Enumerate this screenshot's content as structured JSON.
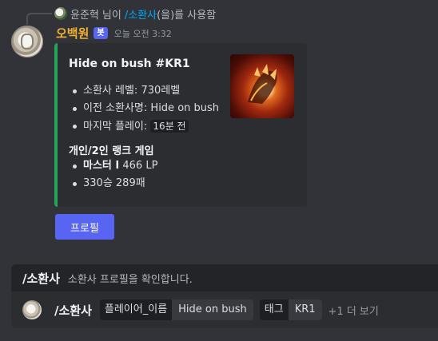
{
  "reply": {
    "user": "윤준혁",
    "suffix": "님이",
    "command": "/소환사",
    "trail": "(을)를 사용함"
  },
  "message": {
    "username": "오백원",
    "bot_tag": "봇",
    "timestamp": "오늘 오전 3:32",
    "username_color": "#f0b132"
  },
  "embed": {
    "accent_color": "#23a559",
    "title": "Hide on bush #KR1",
    "items": [
      {
        "label": "소환사 레벨:",
        "value": "730레벨"
      },
      {
        "label": "이전 소환사명:",
        "value": "Hide on bush"
      },
      {
        "label": "마지막 플레이:",
        "value": "16분 전"
      }
    ],
    "rank_heading": "개인/2인 랭크 게임",
    "rank_tier": "마스터 I",
    "rank_lp": "466 LP",
    "rank_record": "330승 289패"
  },
  "button": {
    "label": "프로필"
  },
  "command_panel": {
    "name": "/소환사",
    "description": "소환사 프로필을 확인합니다.",
    "row_command": "/소환사",
    "options": [
      {
        "name": "플레이어_이름",
        "value": "Hide on bush"
      },
      {
        "name": "태그",
        "value": "KR1"
      }
    ],
    "more": "+1 더 보기"
  },
  "colors": {
    "background": "#313338",
    "embed_bg": "#2b2d31",
    "blurple": "#5865f2",
    "link": "#00a8fc"
  }
}
